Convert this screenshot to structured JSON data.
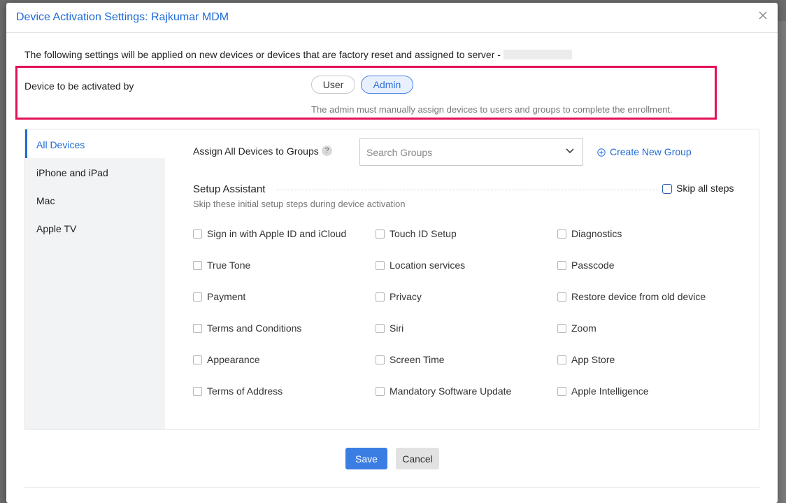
{
  "dialog": {
    "title": "Device Activation Settings: Rajkumar MDM",
    "intro": "The following settings will be applied on new devices or devices that are factory reset and assigned to server -"
  },
  "activation": {
    "label": "Device to be activated by",
    "options": [
      "User",
      "Admin"
    ],
    "selected": "Admin",
    "help": "The admin must manually assign devices to users and groups to complete the enrollment."
  },
  "sidebar": {
    "items": [
      {
        "label": "All Devices"
      },
      {
        "label": "iPhone and iPad"
      },
      {
        "label": "Mac"
      },
      {
        "label": "Apple TV"
      }
    ],
    "active": "All Devices"
  },
  "groups": {
    "label": "Assign All Devices to Groups",
    "help_icon": "?",
    "placeholder": "Search Groups",
    "create_label": "Create New Group"
  },
  "setup_assistant": {
    "title": "Setup Assistant",
    "skip_all_label": "Skip all steps",
    "subtitle": "Skip these initial setup steps during device activation",
    "options": [
      [
        "Sign in with Apple ID and iCloud",
        "Touch ID Setup",
        "Diagnostics"
      ],
      [
        "True Tone",
        "Location services",
        "Passcode"
      ],
      [
        "Payment",
        "Privacy",
        "Restore device from old device"
      ],
      [
        "Terms and Conditions",
        "Siri",
        "Zoom"
      ],
      [
        "Appearance",
        "Screen Time",
        "App Store"
      ],
      [
        "Terms of Address",
        "Mandatory Software Update",
        "Apple Intelligence"
      ]
    ]
  },
  "footer": {
    "save_label": "Save",
    "cancel_label": "Cancel"
  },
  "colors": {
    "accent": "#1e6bd6",
    "highlight_border": "#e4105a",
    "save_bg": "#3b7ee3"
  }
}
